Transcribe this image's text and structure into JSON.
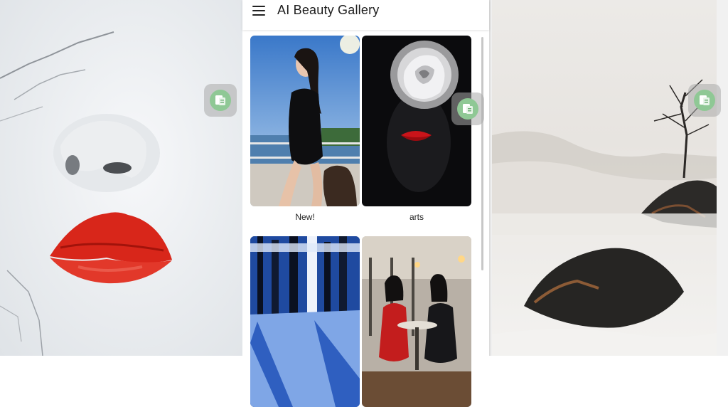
{
  "app": {
    "title": "AI Beauty Gallery"
  },
  "gallery": {
    "items": [
      {
        "label": "New!"
      },
      {
        "label": "arts"
      },
      {
        "label": ""
      },
      {
        "label": ""
      }
    ]
  },
  "icons": {
    "menu": "hamburger-menu-icon",
    "translate": "translate-icon"
  },
  "colors": {
    "accent_green": "#8fc895",
    "lip_red": "#d8261a"
  }
}
